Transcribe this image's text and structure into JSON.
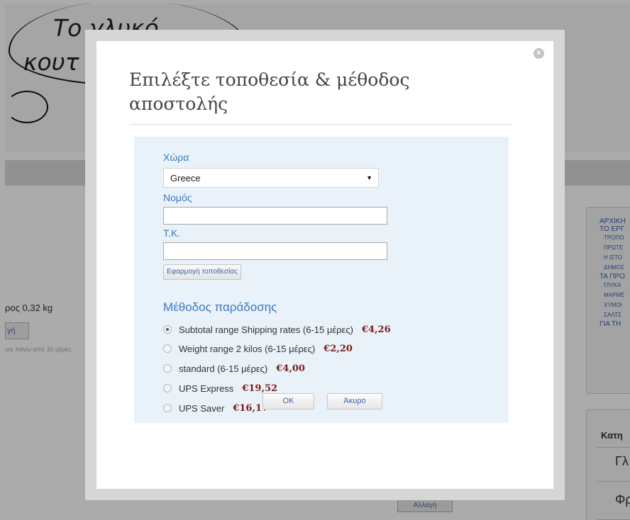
{
  "background": {
    "logo_line1": "Το γλυκό",
    "logo_line2": "κουτ",
    "weight_text": "ρος 0,32 kg",
    "button1_label": "γή",
    "note_text": "για πάνω από 30 μέρες",
    "button2_label": "Αλλαγή",
    "sidebar_nav": [
      {
        "label": "ΑΡΧΙΚΗ",
        "sub": false
      },
      {
        "label": "ΤΟ ΕΡΓ",
        "sub": false
      },
      {
        "label": "ΤΡΟΠΟ",
        "sub": true
      },
      {
        "label": "ΠΡΩΤΕ",
        "sub": true
      },
      {
        "label": "Η ΙΣΤΟ",
        "sub": true
      },
      {
        "label": "ΔΗΜΟΣ",
        "sub": true
      },
      {
        "label": "ΤΑ ΠΡΟ",
        "sub": false
      },
      {
        "label": "ΓΛΥΚΑ",
        "sub": true
      },
      {
        "label": "ΜΑΡΜΕ",
        "sub": true
      },
      {
        "label": "ΧΥΜΟΙ",
        "sub": true
      },
      {
        "label": "ΣΑΛΤΣ",
        "sub": true
      },
      {
        "label": "ΓΙΑ ΤΗ",
        "sub": false
      }
    ],
    "categories_title": "Κατη",
    "category_row1": "Γλ",
    "category_row2": "Φρ"
  },
  "modal": {
    "close_glyph": "×",
    "title": "Επιλέξτε τοποθεσία & μέθοδος αποστολής",
    "country_label": "Χώρα",
    "country_selected": "Greece",
    "region_label": "Νομός",
    "region_value": "",
    "zip_label": "Τ.Κ.",
    "zip_value": "",
    "apply_button": "Εφαρμογή τοποθεσίας",
    "delivery_title": "Μέθοδος παράδοσης",
    "options": [
      {
        "label": "Subtotal range Shipping rates (6-15 μέρες)",
        "price": "€4,26",
        "selected": true
      },
      {
        "label": "Weight range 2 kilos (6-15 μέρες)",
        "price": "€2,20",
        "selected": false
      },
      {
        "label": "standard (6-15 μέρες)",
        "price": "€4,00",
        "selected": false
      },
      {
        "label": "UPS Express",
        "price": "€19,52",
        "selected": false
      },
      {
        "label": "UPS Saver",
        "price": "€16,17",
        "selected": false
      }
    ],
    "ok_button": "OK",
    "cancel_button": "Άκυρο"
  }
}
